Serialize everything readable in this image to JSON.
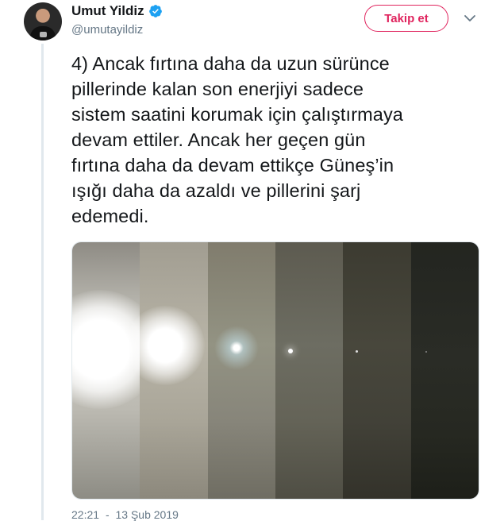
{
  "tweet": {
    "author": {
      "name": "Umut Yildiz",
      "handle": "@umutayildiz",
      "verified": true
    },
    "follow_label": "Takip et",
    "text_lines": [
      "4) Ancak fırtına daha da uzun sürünce",
      "pillerinde kalan son enerjiyi sadece",
      "sistem saatini korumak için çalıştırmaya",
      "devam ettiler. Ancak her geçen gün",
      "fırtına daha da devam ettikçe Güneş’in",
      "ışığı daha da azaldı ve pillerini şarj",
      "edemedi."
    ],
    "time": "22:21",
    "separator": "-",
    "date": "13 Şub 2019"
  },
  "icons": {
    "verified": "verified-badge-icon",
    "caret": "chevron-down-icon"
  },
  "colors": {
    "follow_accent": "#e0245e",
    "verified_blue": "#1da1f2",
    "secondary_text": "#657786",
    "thread_line": "#e1e8ed"
  }
}
